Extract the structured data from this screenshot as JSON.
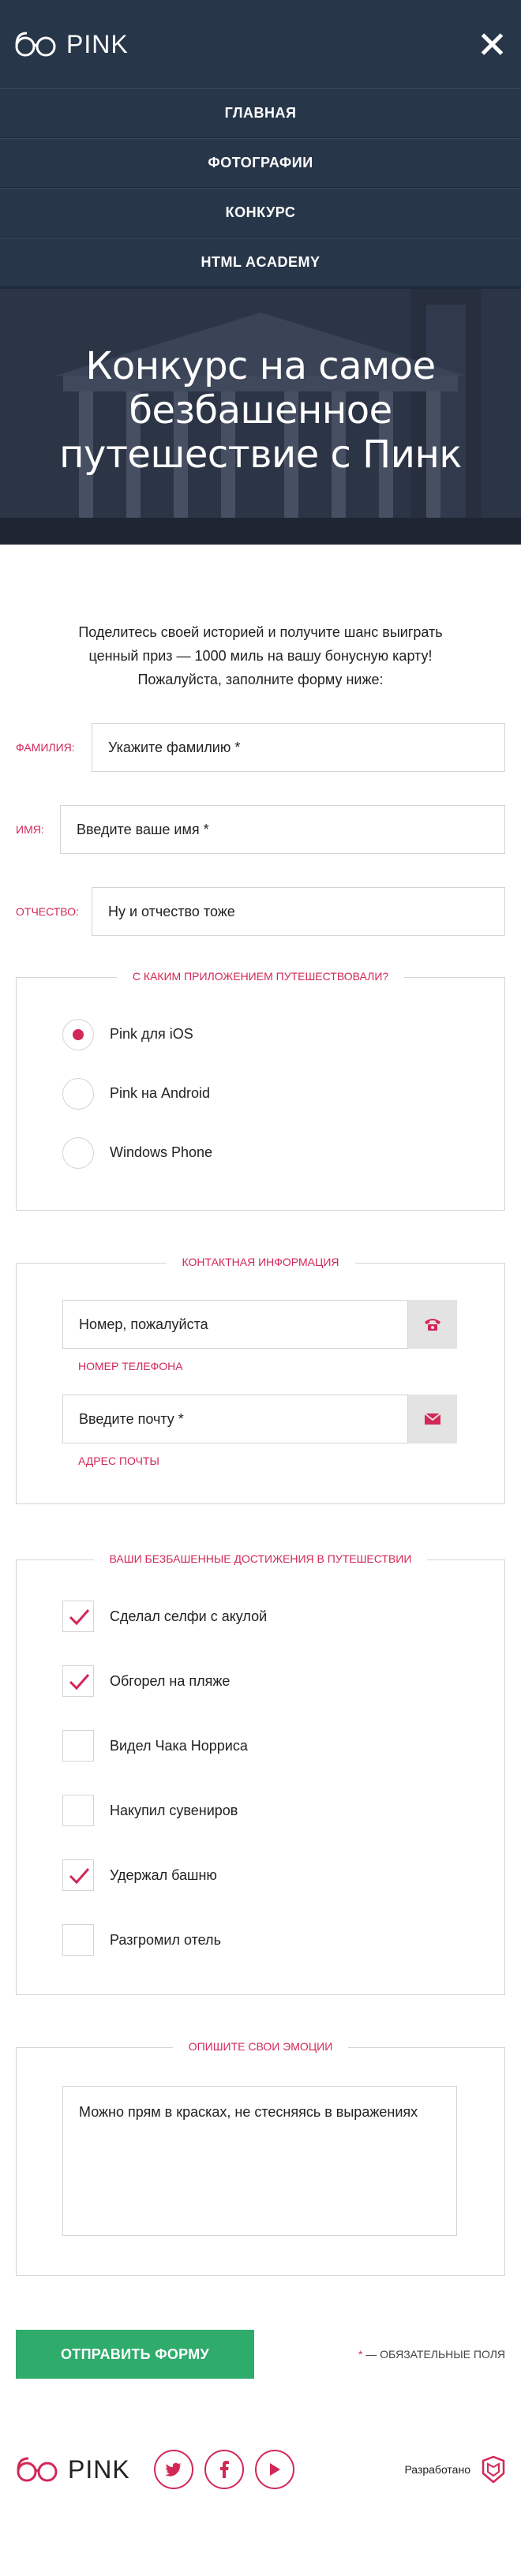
{
  "header": {
    "logo_text": "PINK",
    "nav": [
      {
        "label": "ГЛАВНАЯ"
      },
      {
        "label": "ФОТОГРАФИИ"
      },
      {
        "label": "КОНКУРС"
      },
      {
        "label": "HTML ACADEMY"
      }
    ],
    "hero_title_lines": [
      "Конкурс на самое",
      "безбашенное",
      "путешествие с Пинк"
    ]
  },
  "intro": {
    "lines": [
      "Поделитесь своей историей и получите шанс выиграть",
      "ценный приз — 1000 миль на вашу бонусную карту!",
      "Пожалуйста, заполните форму ниже:"
    ]
  },
  "name_fields": [
    {
      "label": "ФАМИЛИЯ:",
      "placeholder": "Укажите фамилию *"
    },
    {
      "label": "ИМЯ:",
      "placeholder": "Введите ваше имя *"
    },
    {
      "label": "ОТЧЕСТВО:",
      "placeholder": "Ну и отчество тоже"
    }
  ],
  "app_section": {
    "legend": "С КАКИМ ПРИЛОЖЕНИЕМ ПУТЕШЕСТВОВАЛИ?",
    "options": [
      {
        "label": "Pink для iOS",
        "checked": true
      },
      {
        "label": "Pink на Android",
        "checked": false
      },
      {
        "label": "Windows Phone",
        "checked": false
      }
    ]
  },
  "contact_section": {
    "legend": "КОНТАКТНАЯ ИНФОРМАЦИЯ",
    "phone_placeholder": "Номер, пожалуйста",
    "phone_hint": "НОМЕР ТЕЛЕФОНА",
    "email_placeholder": "Введите почту *",
    "email_hint": "АДРЕС ПОЧТЫ"
  },
  "achievements_section": {
    "legend": "ВАШИ БЕЗБАШЕННЫЕ ДОСТИЖЕНИЯ В ПУТЕШЕСТВИИ",
    "items": [
      {
        "label": "Сделал селфи с акулой",
        "checked": true
      },
      {
        "label": "Обгорел на пляже",
        "checked": true
      },
      {
        "label": "Видел Чака Норриса",
        "checked": false
      },
      {
        "label": "Накупил сувениров",
        "checked": false
      },
      {
        "label": "Удержал башню",
        "checked": true
      },
      {
        "label": "Разгромил отель",
        "checked": false
      }
    ]
  },
  "emotions_section": {
    "legend": "ОПИШИТЕ СВОИ ЭМОЦИИ",
    "placeholder": "Можно прям в красках, не стесняясь в выражениях"
  },
  "submit": {
    "button_label": "ОТПРАВИТЬ ФОРМУ",
    "required_star": "*",
    "required_text": " — ОБЯЗАТЕЛЬНЫЕ ПОЛЯ"
  },
  "footer": {
    "logo_text": "PINK",
    "socials": [
      {
        "icon": "twitter-icon"
      },
      {
        "icon": "facebook-icon"
      },
      {
        "icon": "youtube-icon"
      }
    ],
    "made_by": "Разработано"
  },
  "colors": {
    "brand_dark": "#283649",
    "accent": "#d22856",
    "submit_green": "#2fab6c"
  }
}
